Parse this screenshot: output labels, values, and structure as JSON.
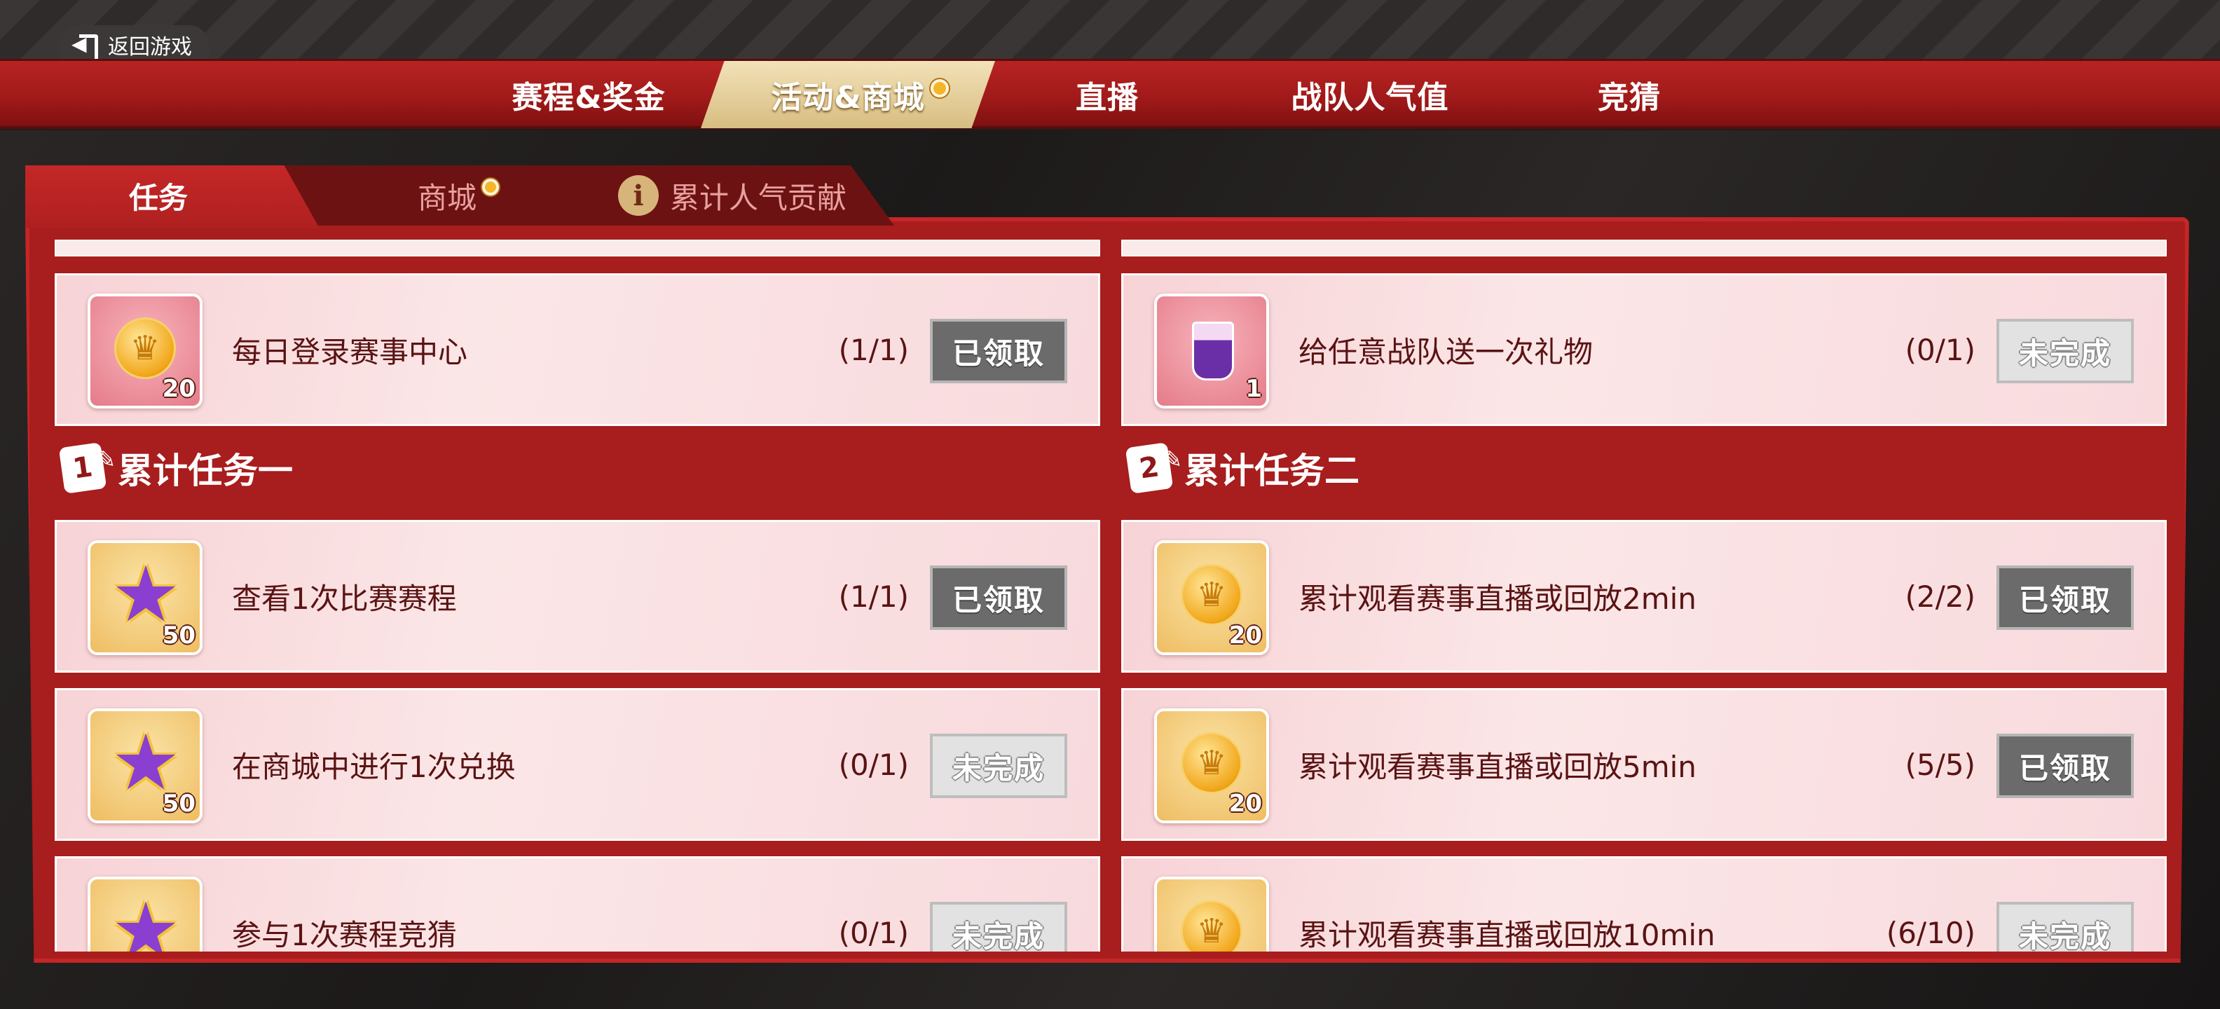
{
  "back": {
    "label": "返回游戏",
    "icon": "exit-icon"
  },
  "topnav": {
    "tabs": [
      {
        "label": "赛程&奖金",
        "active": false
      },
      {
        "label": "活动&商城",
        "active": true,
        "dot": true
      },
      {
        "label": "直播",
        "active": false
      },
      {
        "label": "战队人气值",
        "active": false
      },
      {
        "label": "竞猜",
        "active": false
      }
    ]
  },
  "subtabs": [
    {
      "label": "任务",
      "active": true
    },
    {
      "label": "商城",
      "active": false,
      "dot": true
    },
    {
      "label": "累计人气贡献",
      "active": false,
      "icon": "info-icon"
    }
  ],
  "status": {
    "claimed": "已领取",
    "todo": "未完成"
  },
  "daily": [
    {
      "reward_icon": "gold-coin-icon",
      "reward_qty": "20",
      "label": "每日登录赛事中心",
      "progress": "(1/1)",
      "status": "已领取",
      "thumb": "pink"
    },
    {
      "reward_icon": "gift-drink-icon",
      "reward_qty": "1",
      "label": "给任意战队送一次礼物",
      "progress": "(0/1)",
      "status": "未完成",
      "thumb": "pink"
    }
  ],
  "sections": [
    {
      "number": "1",
      "title": "累计任务一",
      "tasks": [
        {
          "reward_icon": "purple-star-icon",
          "reward_qty": "50",
          "label": "查看1次比赛赛程",
          "progress": "(1/1)",
          "status": "已领取"
        },
        {
          "reward_icon": "purple-star-icon",
          "reward_qty": "50",
          "label": "在商城中进行1次兑换",
          "progress": "(0/1)",
          "status": "未完成"
        },
        {
          "reward_icon": "purple-star-icon",
          "reward_qty": "",
          "label": "参与1次赛程竞猜",
          "progress": "(0/1)",
          "status": "未完成"
        }
      ]
    },
    {
      "number": "2",
      "title": "累计任务二",
      "tasks": [
        {
          "reward_icon": "gold-coin-icon",
          "reward_qty": "20",
          "label": "累计观看赛事直播或回放2min",
          "progress": "(2/2)",
          "status": "已领取"
        },
        {
          "reward_icon": "gold-coin-icon",
          "reward_qty": "20",
          "label": "累计观看赛事直播或回放5min",
          "progress": "(5/5)",
          "status": "已领取"
        },
        {
          "reward_icon": "gold-coin-icon",
          "reward_qty": "",
          "label": "累计观看赛事直播或回放10min",
          "progress": "(6/10)",
          "status": "未完成"
        }
      ]
    }
  ]
}
